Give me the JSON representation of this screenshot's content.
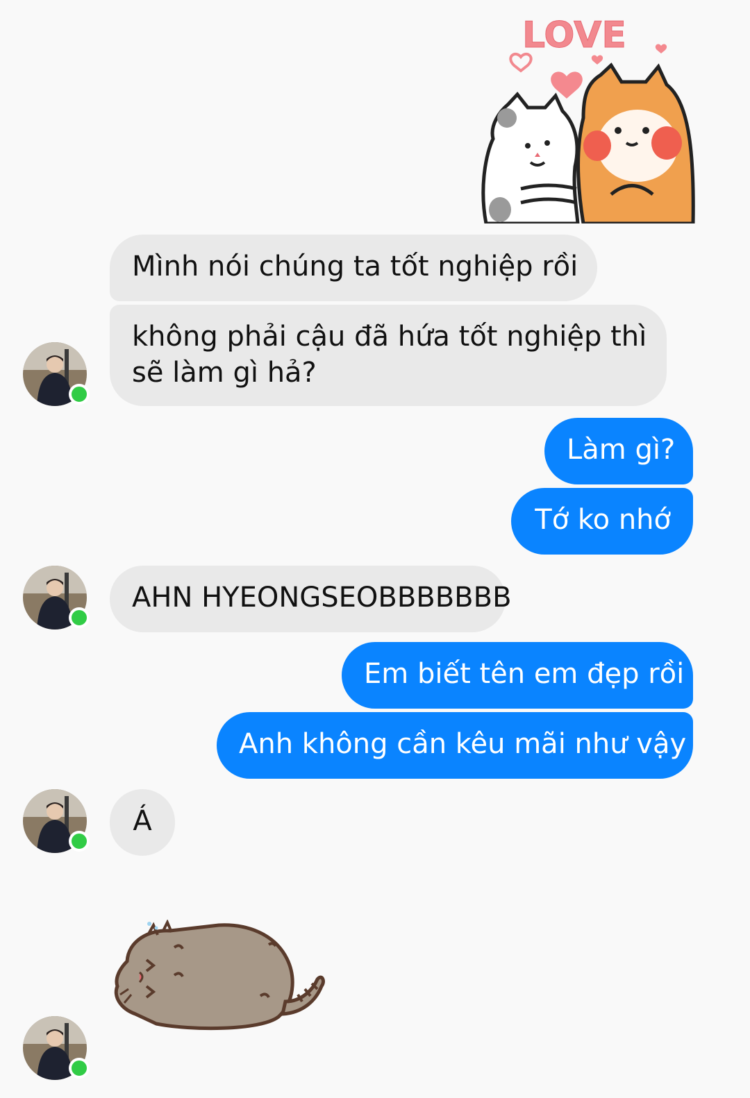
{
  "conversation": {
    "sticker_top": {
      "icon": "love-cat-dog-sticker",
      "text": "LOVE"
    },
    "messages": [
      {
        "id": "m1",
        "sender": "them",
        "text": "Mình nói chúng ta tốt nghiệp rồi"
      },
      {
        "id": "m2",
        "sender": "them",
        "text_line1": "không phải cậu đã hứa tốt nghiệp thì",
        "text_line2": "sẽ làm gì hả?"
      },
      {
        "id": "m3",
        "sender": "me",
        "text": "Làm gì?"
      },
      {
        "id": "m4",
        "sender": "me",
        "text": "Tớ ko nhớ"
      },
      {
        "id": "m5",
        "sender": "them",
        "text": "AHN HYEONGSEOBBBBBBB"
      },
      {
        "id": "m6",
        "sender": "me",
        "text": "Em biết tên em đẹp rồi"
      },
      {
        "id": "m7",
        "sender": "me",
        "text": "Anh không cần kêu mãi như vậy"
      },
      {
        "id": "m8",
        "sender": "them",
        "text": "Á"
      }
    ],
    "sticker_bottom": {
      "icon": "pusheen-cat-sticker"
    }
  },
  "colors": {
    "outgoing_bubble": "#0a84ff",
    "incoming_bubble": "#e9e9e9",
    "background": "#f9f9f9",
    "online_indicator": "#31cc46"
  }
}
